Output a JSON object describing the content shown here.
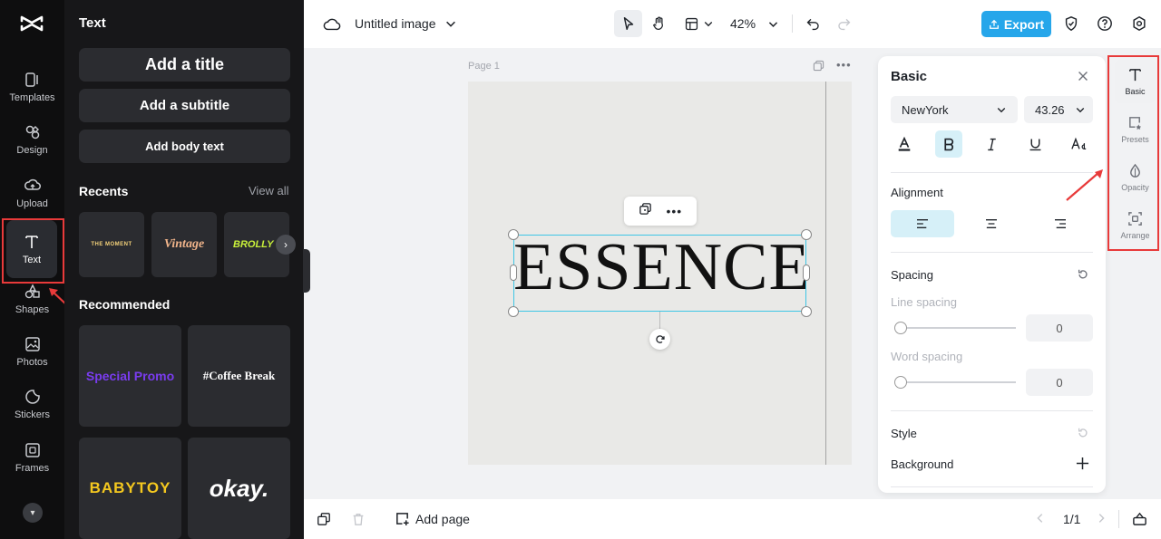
{
  "rail": {
    "items": [
      {
        "label": "Templates",
        "icon": "templates-icon"
      },
      {
        "label": "Design",
        "icon": "design-icon"
      },
      {
        "label": "Upload",
        "icon": "upload-icon"
      },
      {
        "label": "Text",
        "icon": "text-icon"
      },
      {
        "label": "Shapes",
        "icon": "shapes-icon"
      },
      {
        "label": "Photos",
        "icon": "photos-icon"
      },
      {
        "label": "Stickers",
        "icon": "stickers-icon"
      },
      {
        "label": "Frames",
        "icon": "frames-icon"
      }
    ]
  },
  "text_panel": {
    "title": "Text",
    "add_title": "Add a title",
    "add_subtitle": "Add a subtitle",
    "add_body": "Add body text",
    "recents_title": "Recents",
    "view_all": "View all",
    "recents": [
      "THE MOMENT",
      "Vintage",
      "BROLLY HO"
    ],
    "recommended_title": "Recommended",
    "recommended": [
      "Special Promo",
      "#Coffee Break",
      "BABYTOY",
      "okay."
    ]
  },
  "topbar": {
    "doc_title": "Untitled image",
    "zoom": "42%",
    "export_label": "Export"
  },
  "canvas": {
    "page_label": "Page 1",
    "text": "ESSENCE"
  },
  "basic_panel": {
    "title": "Basic",
    "font": "NewYork",
    "size": "43.26",
    "alignment_label": "Alignment",
    "spacing_label": "Spacing",
    "line_spacing_label": "Line spacing",
    "line_spacing_value": "0",
    "word_spacing_label": "Word spacing",
    "word_spacing_value": "0",
    "style_label": "Style",
    "background_label": "Background"
  },
  "right_tools": [
    "Basic",
    "Presets",
    "Opacity",
    "Arrange"
  ],
  "bottombar": {
    "add_page": "Add page",
    "page_count": "1/1"
  },
  "colors": {
    "accent": "#26a6ea",
    "selection": "#3ec6e6",
    "annotation": "#e83a3a"
  }
}
